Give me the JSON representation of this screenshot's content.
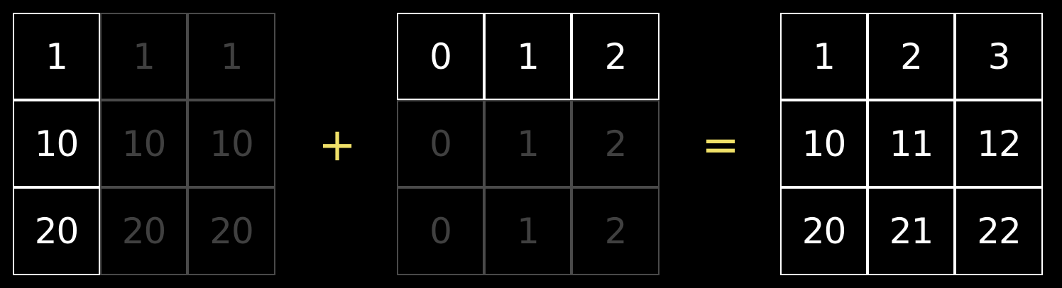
{
  "colors": {
    "background": "#000000",
    "bright": "#ffffff",
    "dim": "#404040",
    "operator": "#f0e068"
  },
  "operators": {
    "plus": "+",
    "equals": "="
  },
  "matrices": [
    {
      "name": "column-vector-broadcast",
      "rows": [
        [
          {
            "v": "1",
            "hl": true
          },
          {
            "v": "1",
            "hl": false
          },
          {
            "v": "1",
            "hl": false
          }
        ],
        [
          {
            "v": "10",
            "hl": true
          },
          {
            "v": "10",
            "hl": false
          },
          {
            "v": "10",
            "hl": false
          }
        ],
        [
          {
            "v": "20",
            "hl": true
          },
          {
            "v": "20",
            "hl": false
          },
          {
            "v": "20",
            "hl": false
          }
        ]
      ]
    },
    {
      "name": "row-vector-broadcast",
      "rows": [
        [
          {
            "v": "0",
            "hl": true
          },
          {
            "v": "1",
            "hl": true
          },
          {
            "v": "2",
            "hl": true
          }
        ],
        [
          {
            "v": "0",
            "hl": false
          },
          {
            "v": "1",
            "hl": false
          },
          {
            "v": "2",
            "hl": false
          }
        ],
        [
          {
            "v": "0",
            "hl": false
          },
          {
            "v": "1",
            "hl": false
          },
          {
            "v": "2",
            "hl": false
          }
        ]
      ]
    },
    {
      "name": "result",
      "rows": [
        [
          {
            "v": "1",
            "hl": true
          },
          {
            "v": "2",
            "hl": true
          },
          {
            "v": "3",
            "hl": true
          }
        ],
        [
          {
            "v": "10",
            "hl": true
          },
          {
            "v": "11",
            "hl": true
          },
          {
            "v": "12",
            "hl": true
          }
        ],
        [
          {
            "v": "20",
            "hl": true
          },
          {
            "v": "21",
            "hl": true
          },
          {
            "v": "22",
            "hl": true
          }
        ]
      ]
    }
  ]
}
